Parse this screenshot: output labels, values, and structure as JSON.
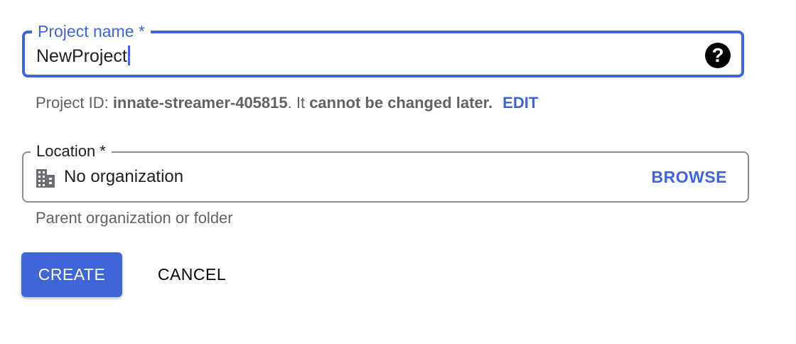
{
  "project_name": {
    "label": "Project name *",
    "value": "NewProject",
    "help_icon": "help-circle-icon",
    "focused": true
  },
  "project_id": {
    "prefix": "Project ID: ",
    "id": "innate-streamer-405815",
    "middle": ". It ",
    "notice": "cannot be changed later.",
    "edit_label": "EDIT"
  },
  "location": {
    "label": "Location *",
    "icon": "building-icon",
    "value": "No organization",
    "browse_label": "BROWSE",
    "helper": "Parent organization or folder"
  },
  "actions": {
    "create_label": "CREATE",
    "cancel_label": "CANCEL"
  },
  "colors": {
    "accent": "#3f66d6",
    "text_primary": "#202124",
    "text_secondary": "#5f6368",
    "border": "#8a8d91"
  }
}
